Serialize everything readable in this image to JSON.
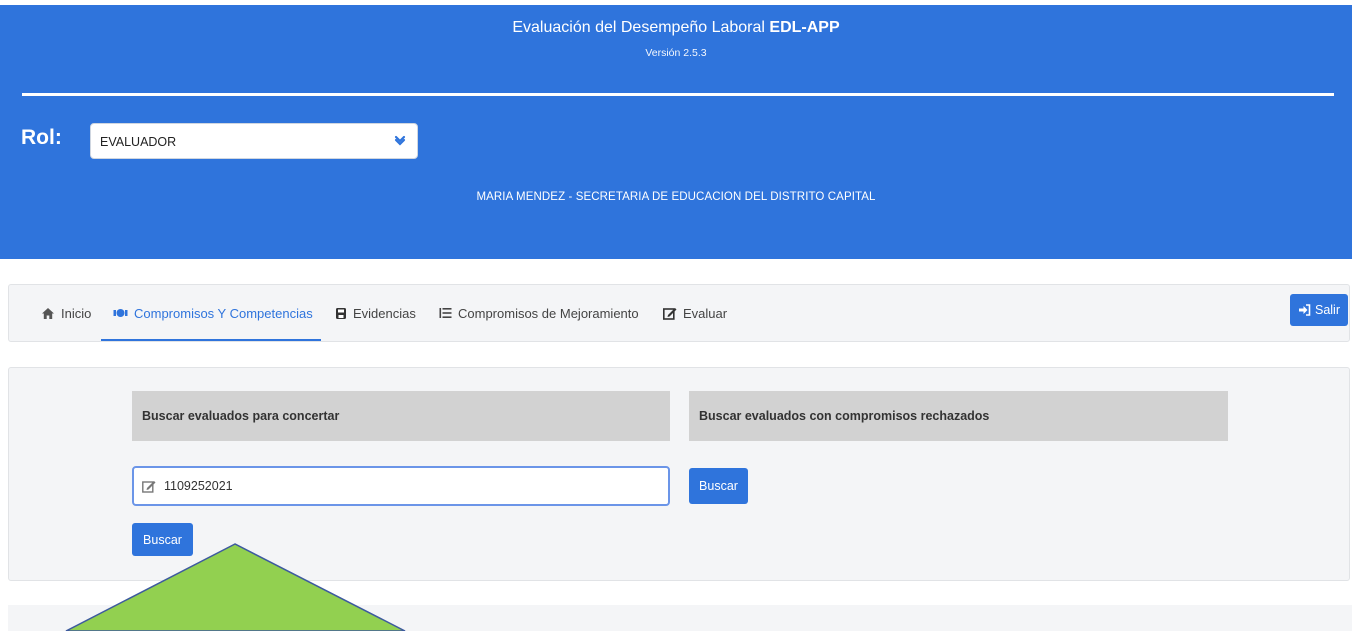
{
  "header": {
    "title_prefix": "Evaluación del Desempeño Laboral",
    "title_app": "EDL-APP",
    "version": "Versión 2.5.3",
    "rol_label": "Rol:",
    "rol_selected": "EVALUADOR",
    "user_line": "MARIA MENDEZ - SECRETARIA DE EDUCACION DEL DISTRITO CAPITAL",
    "background_color": "#2f74dc"
  },
  "nav": {
    "items": [
      {
        "label": "Inicio",
        "icon": "home-icon"
      },
      {
        "label": "Compromisos Y Competencias",
        "icon": "handshake-icon",
        "active": true
      },
      {
        "label": "Evidencias",
        "icon": "lock-icon"
      },
      {
        "label": "Compromisos de Mejoramiento",
        "icon": "list-icon"
      },
      {
        "label": "Evaluar",
        "icon": "edit-icon"
      }
    ],
    "logout_label": "Salir",
    "logout_icon": "sign-in-icon"
  },
  "search": {
    "left_heading": "Buscar evaluados para concertar",
    "right_heading": "Buscar evaluados con compromisos rechazados",
    "input_value": "1109252021",
    "input_icon": "edit-icon",
    "left_button_label": "Buscar",
    "right_button_label": "Buscar"
  },
  "colors": {
    "primary": "#2f74dc",
    "panel": "#f4f5f7",
    "section_header": "#d2d2d2",
    "callout_fill": "#92d050",
    "callout_stroke": "#3d5a9e"
  }
}
